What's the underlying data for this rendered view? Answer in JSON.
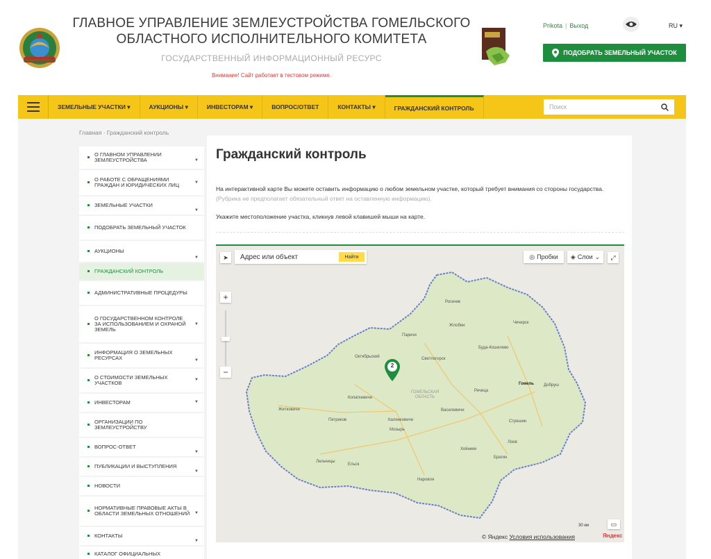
{
  "header": {
    "title_line1": "ГЛАВНОЕ УПРАВЛЕНИЕ ЗЕМЛЕУСТРОЙСТВА ГОМЕЛЬСКОГО",
    "title_line2": "ОБЛАСТНОГО ИСПОЛНИТЕЛЬНОГО КОМИТЕТА",
    "subtitle": "ГОСУДАРСТВЕННЫЙ ИНФОРМАЦИОННЫЙ РЕСУРС",
    "warning": "Внимание! Сайт работает в тестовом режиме.",
    "user_link": "Prikota",
    "logout_link": "Выход",
    "lang": "RU",
    "cta_label": "ПОДОБРАТЬ ЗЕМЕЛЬНЫЙ УЧАСТОК"
  },
  "nav": {
    "items": [
      {
        "label": "ЗЕМЕЛЬНЫЕ УЧАСТКИ ▾"
      },
      {
        "label": "АУКЦИОНЫ ▾"
      },
      {
        "label": "ИНВЕСТОРАМ ▾"
      },
      {
        "label": "ВОПРОС/ОТВЕТ"
      },
      {
        "label": "КОНТАКТЫ ▾"
      },
      {
        "label": "ГРАЖДАНСКИЙ КОНТРОЛЬ"
      }
    ],
    "search_placeholder": "Поиск"
  },
  "breadcrumb": "Главная · Гражданский контроль",
  "sidebar": {
    "items": [
      {
        "label": "О ГЛАВНОМ УПРАВЛЕНИИ ЗЕМЛЕУСТРОЙСТВА"
      },
      {
        "label": "О РАБОТЕ С ОБРАЩЕНИЯМИ ГРАЖДАН И ЮРИДИЧЕСКИХ ЛИЦ"
      },
      {
        "label": "ЗЕМЕЛЬНЫЕ УЧАСТКИ"
      },
      {
        "label": "ПОДОБРАТЬ ЗЕМЕЛЬНЫЙ УЧАСТОК"
      },
      {
        "label": "АУКЦИОНЫ"
      },
      {
        "label": "ГРАЖДАНСКИЙ КОНТРОЛЬ"
      },
      {
        "label": "АДМИНИСТРАТИВНЫЕ ПРОЦЕДУРЫ"
      },
      {
        "label": "О ГОСУДАРСТВЕННОМ КОНТРОЛЕ ЗА ИСПОЛЬЗОВАНИЕМ И ОХРАНОЙ ЗЕМЕЛЬ"
      },
      {
        "label": "ИНФОРМАЦИЯ О ЗЕМЕЛЬНЫХ РЕСУРСАХ"
      },
      {
        "label": "О СТОИМОСТИ ЗЕМЕЛЬНЫХ УЧАСТКОВ"
      },
      {
        "label": "ИНВЕСТОРАМ"
      },
      {
        "label": "ОРГАНИЗАЦИИ ПО ЗЕМЛЕУСТРОЙСТВУ"
      },
      {
        "label": "ВОПРОС-ОТВЕТ"
      },
      {
        "label": "ПУБЛИКАЦИИ И ВЫСТУПЛЕНИЯ"
      },
      {
        "label": "НОВОСТИ"
      },
      {
        "label": "НОРМАТИВНЫЕ ПРАВОВЫЕ АКТЫ В ОБЛАСТИ ЗЕМЕЛЬНЫХ ОТНОШЕНИЙ"
      },
      {
        "label": "КОНТАКТЫ"
      },
      {
        "label": "КАТАЛОГ ОФИЦИАЛЬНЫХ"
      }
    ]
  },
  "main": {
    "title": "Гражданский контроль",
    "intro": "На интерактивной карте Вы можете оставить информацию о любом земельном участке, который требует внимания со стороны государства.",
    "intro_note": "(Рубрика не предполагает обязательный ответ на оставленную информацию).",
    "hint": "Укажите местоположение участка, кликнув левой клавишей мыши на карте."
  },
  "map": {
    "search_placeholder": "Адрес или объект",
    "find_label": "Найти",
    "traffic_label": "Пробки",
    "layers_label": "Слои",
    "marker_count": "2",
    "region_label": "ГОМЕЛЬСКАЯ ОБЛАСТЬ",
    "scale_label": "30 км",
    "copyright": "© Яндекс",
    "terms_link": "Условия использования",
    "yandex_logo": "Яндекс",
    "cities": [
      {
        "name": "Рогачев"
      },
      {
        "name": "Чечерск"
      },
      {
        "name": "Жлобин"
      },
      {
        "name": "Паричи"
      },
      {
        "name": "Буда-Кошелево"
      },
      {
        "name": "Октябрьский"
      },
      {
        "name": "Светлогорск"
      },
      {
        "name": "Гомель"
      },
      {
        "name": "Добруш"
      },
      {
        "name": "Копаткевичи"
      },
      {
        "name": "Речица"
      },
      {
        "name": "Житковичи"
      },
      {
        "name": "Петриков"
      },
      {
        "name": "Калинковичи"
      },
      {
        "name": "Мозырь"
      },
      {
        "name": "Лоев"
      },
      {
        "name": "Хойники"
      },
      {
        "name": "Лельчицы"
      },
      {
        "name": "Ельск"
      },
      {
        "name": "Брагин"
      },
      {
        "name": "Стрешин"
      },
      {
        "name": "Василевичи"
      },
      {
        "name": "Наровля"
      }
    ]
  },
  "colors": {
    "accent": "#1e8e3e",
    "nav_bg": "#f5c518",
    "warning": "#e53935"
  }
}
